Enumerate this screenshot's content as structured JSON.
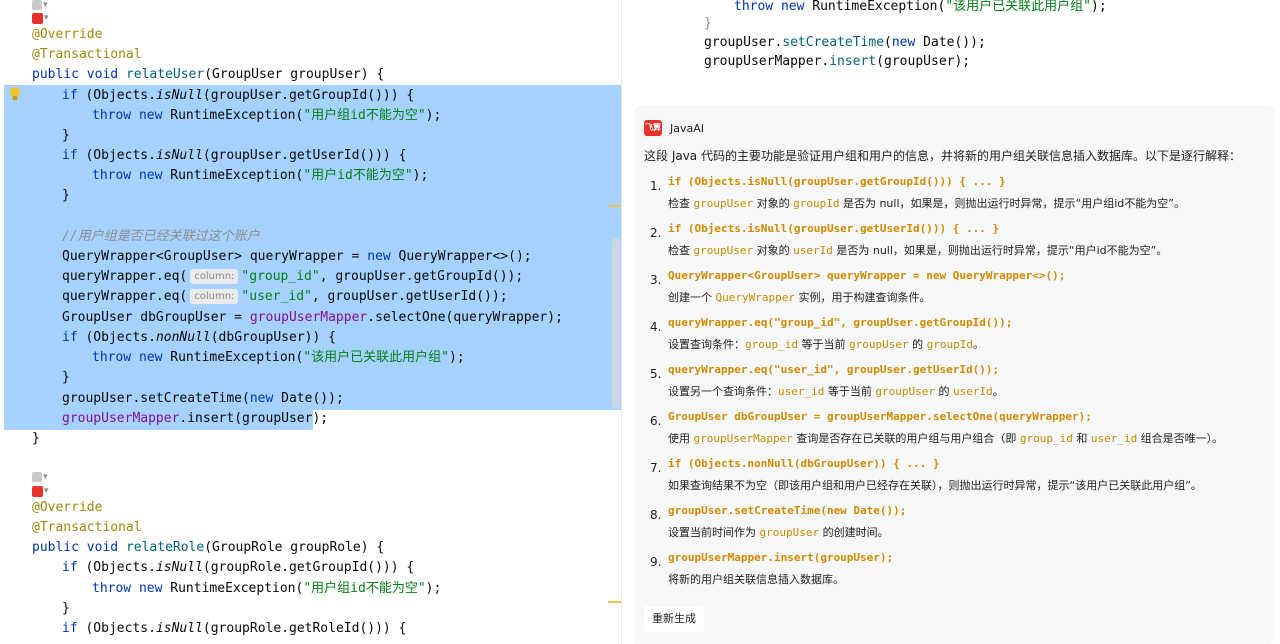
{
  "editor": {
    "method1": {
      "annotation_override": "@Override",
      "annotation_transactional": "@Transactional",
      "kw_public": "public",
      "kw_void": "void",
      "name": "relateUser",
      "params": "(GroupUser groupUser) {",
      "l1_if": "if",
      "l1_cond_a": " (Objects.",
      "l1_isnull": "isNull",
      "l1_cond_b": "(groupUser.getGroupId())) {",
      "l2_throw": "throw",
      "l2_new": "new",
      "l2_exc": " RuntimeException(",
      "l2_str": "\"用户组id不能为空\"",
      "l2_end": ");",
      "close1": "}",
      "l4_cond_b": "(groupUser.getUserId())) {",
      "l5_str": "\"用户id不能为空\"",
      "comment": "//用户组是否已经关联过这个账户",
      "qw_decl": "QueryWrapper<GroupUser> queryWrapper = ",
      "qw_new": "new",
      "qw_end": " QueryWrapper<>();",
      "eq1_pre": "queryWrapper.eq(",
      "hint_column": "column:",
      "eq1_str": "\"group_id\"",
      "eq1_post": ", groupUser.getGroupId());",
      "eq2_str": "\"user_id\"",
      "eq2_post": ", groupUser.getUserId());",
      "db_pre": "GroupUser dbGroupUser = ",
      "db_field": "groupUserMapper",
      "db_post": ".selectOne(queryWrapper);",
      "nn_nonnull": "nonNull",
      "nn_post": "(dbGroupUser)) {",
      "nn_str": "\"该用户已关联此用户组\"",
      "set_pre": "groupUser.setCreateTime(",
      "set_new": "new",
      "set_post": " Date());",
      "ins_field": "groupUserMapper",
      "ins_post": ".insert(groupUser);",
      "close_method": "}"
    },
    "method2": {
      "annotation_override": "@Override",
      "annotation_transactional": "@Transactional",
      "kw_public": "public",
      "kw_void": "void",
      "name": "relateRole",
      "params": "(GroupRole groupRole) {",
      "l1_cond_b": "(groupRole.getGroupId())) {",
      "l2_str": "\"用户组id不能为空\"",
      "l4_cond_b": "(groupRole.getRoleId())) {"
    }
  },
  "preview": {
    "throw": "throw",
    "new": "new",
    "exc": " RuntimeException(",
    "str": "\"该用户已关联此用户组\"",
    "end": ");",
    "close": "}",
    "set_pre": "groupUser.",
    "set_fn": "setCreateTime",
    "set_mid": "(",
    "set_new": "new",
    "set_post": " Date());",
    "ins_field": "groupUserMapper",
    "ins_dot": ".",
    "ins_fn": "insert",
    "ins_post": "(groupUser);"
  },
  "assistant": {
    "name": "JavaAI",
    "logo_text": "飞算",
    "intro": "这段 Java 代码的主要功能是验证用户组和用户的信息，并将新的用户组关联信息插入数据库。以下是逐行解释：",
    "regenerate_label": "重新生成",
    "items": [
      {
        "num": "1.",
        "code": "if (Objects.isNull(groupUser.getGroupId())) { ... }",
        "d0": "检查 ",
        "c1": "groupUser",
        "d1": " 对象的 ",
        "c2": "groupId",
        "d2": " 是否为 null，如果是，则抛出运行时异常，提示“用户组id不能为空”。"
      },
      {
        "num": "2.",
        "code": "if (Objects.isNull(groupUser.getUserId())) { ... }",
        "d0": "检查 ",
        "c1": "groupUser",
        "d1": " 对象的 ",
        "c2": "userId",
        "d2": " 是否为 null，如果是，则抛出运行时异常，提示“用户id不能为空”。"
      },
      {
        "num": "3.",
        "code": "QueryWrapper<GroupUser> queryWrapper = new QueryWrapper<>();",
        "d0": "创建一个 ",
        "c1": "QueryWrapper",
        "d1": " 实例，用于构建查询条件。"
      },
      {
        "num": "4.",
        "code": "queryWrapper.eq(\"group_id\", groupUser.getGroupId());",
        "d0": "设置查询条件：",
        "c1": "group_id",
        "d1": " 等于当前 ",
        "c2": "groupUser",
        "d2": " 的 ",
        "c3": "groupId",
        "d3": "。"
      },
      {
        "num": "5.",
        "code": "queryWrapper.eq(\"user_id\", groupUser.getUserId());",
        "d0": "设置另一个查询条件：",
        "c1": "user_id",
        "d1": " 等于当前 ",
        "c2": "groupUser",
        "d2": " 的 ",
        "c3": "userId",
        "d3": "。"
      },
      {
        "num": "6.",
        "code": "GroupUser dbGroupUser = groupUserMapper.selectOne(queryWrapper);",
        "d0": "使用 ",
        "c1": "groupUserMapper",
        "d1": " 查询是否存在已关联的用户组与用户组合（即 ",
        "c2": "group_id",
        "d2": " 和 ",
        "c3": "user_id",
        "d3": " 组合是否唯一）。"
      },
      {
        "num": "7.",
        "code": "if (Objects.nonNull(dbGroupUser)) { ... }",
        "d0": "如果查询结果不为空（即该用户组和用户已经存在关联），则抛出运行时异常，提示“该用户已关联此用户组”。"
      },
      {
        "num": "8.",
        "code": "groupUser.setCreateTime(new Date());",
        "d0": "设置当前时间作为 ",
        "c1": "groupUser",
        "d1": " 的创建时间。"
      },
      {
        "num": "9.",
        "code": "groupUserMapper.insert(groupUser);",
        "d0": "将新的用户组关联信息插入数据库。"
      }
    ]
  }
}
